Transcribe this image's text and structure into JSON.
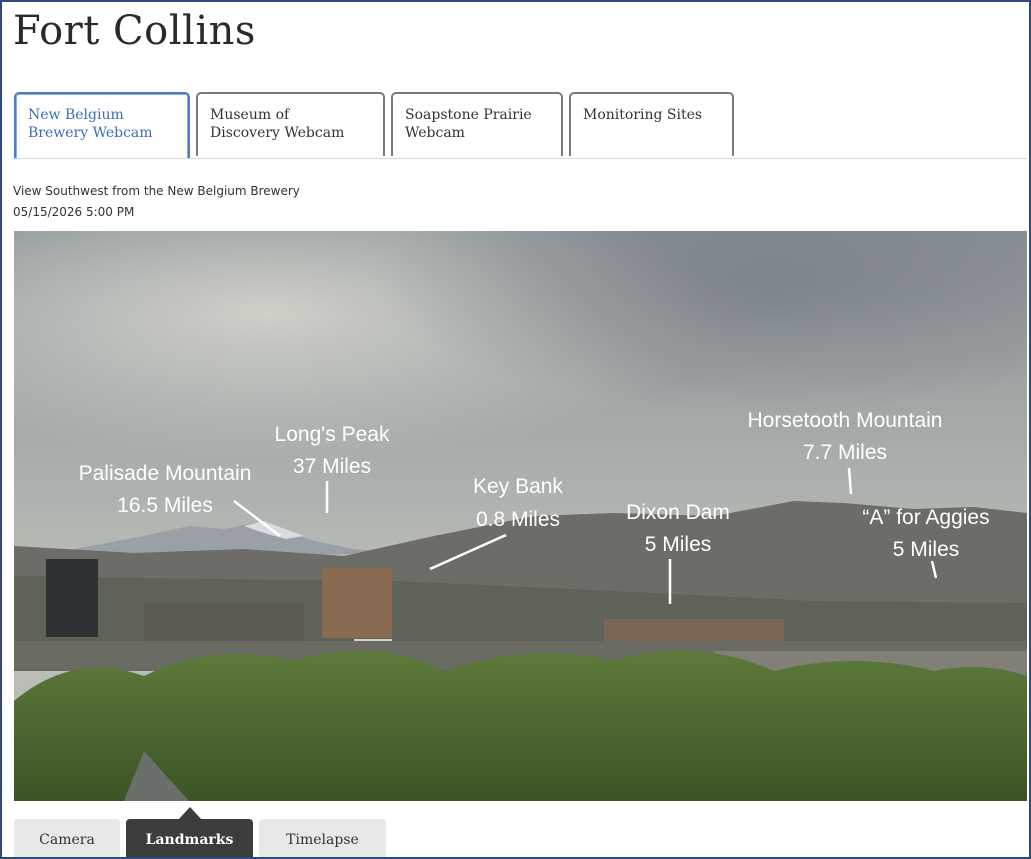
{
  "page": {
    "title": "Fort Collins"
  },
  "tabs": [
    {
      "label_line1": "New Belgium",
      "label_line2": "Brewery Webcam",
      "active": true
    },
    {
      "label_line1": "Museum of",
      "label_line2": "Discovery Webcam",
      "active": false
    },
    {
      "label_line1": "Soapstone Prairie",
      "label_line2": "Webcam",
      "active": false
    },
    {
      "label_line1": "Monitoring Sites",
      "label_line2": "",
      "active": false
    }
  ],
  "camera": {
    "caption": "View Southwest from the New Belgium Brewery",
    "timestamp": "05/15/2026 5:00 PM"
  },
  "landmarks": [
    {
      "name": "Palisade Mountain",
      "distance": "16.5 Miles"
    },
    {
      "name": "Long's Peak",
      "distance": "37 Miles"
    },
    {
      "name": "Key Bank",
      "distance": "0.8 Miles"
    },
    {
      "name": "Dixon Dam",
      "distance": "5 Miles"
    },
    {
      "name": "Horsetooth Mountain",
      "distance": "7.7 Miles"
    },
    {
      "name": "“A” for Aggies",
      "distance": "5 Miles"
    }
  ],
  "view_tabs": {
    "camera": "Camera",
    "landmarks": "Landmarks",
    "timelapse": "Timelapse",
    "selected": "Landmarks"
  },
  "colors": {
    "active_tab": "#3d6fb6",
    "frame_border": "#2f4a7a",
    "selected_view_tab": "#3c3c3c"
  }
}
